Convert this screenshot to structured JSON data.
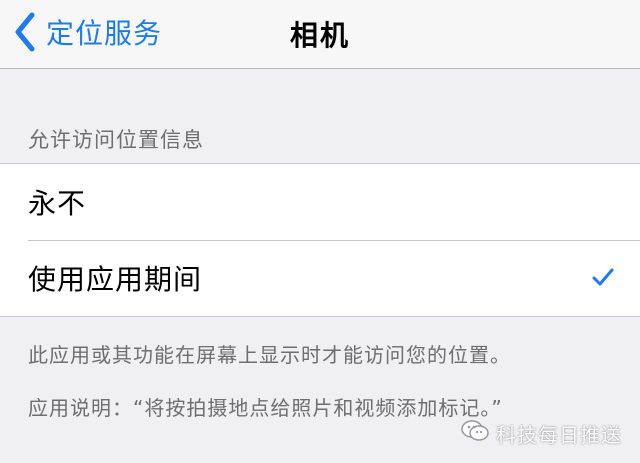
{
  "navbar": {
    "back_label": "定位服务",
    "title": "相机"
  },
  "section": {
    "header": "允许访问位置信息",
    "options": [
      {
        "label": "永不",
        "selected": false
      },
      {
        "label": "使用应用期间",
        "selected": true
      }
    ]
  },
  "footer": {
    "line1": "此应用或其功能在屏幕上显示时才能访问您的位置。",
    "line2": "应用说明：“将按拍摄地点给照片和视频添加标记。”"
  },
  "watermark": {
    "label": "科技每日推送"
  },
  "colors": {
    "accent": "#1a7cf0",
    "background": "#efeff4",
    "secondary_text": "#6d6d72"
  },
  "icons": {
    "back": "chevron-left-icon",
    "check": "checkmark-icon",
    "watermark": "wechat-icon"
  }
}
